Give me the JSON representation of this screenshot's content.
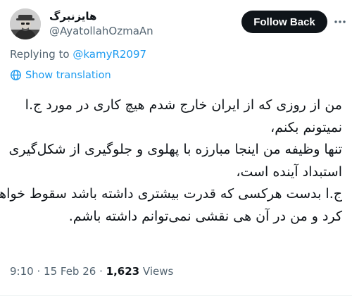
{
  "author": {
    "display_name": "هایزنبرگ",
    "handle": "@AyatollahOzmaAn"
  },
  "follow_button": {
    "label": "Follow Back"
  },
  "more_icon": "more-horizontal-icon",
  "reply_context": {
    "prefix": "Replying to ",
    "mention": "@kamyR2097"
  },
  "translation": {
    "icon": "globe-icon",
    "label": "Show translation"
  },
  "tweet": {
    "lines": [
      "من از روزی که از ایران خارج شدم هیچ کاری در مورد ج.ا",
      "نمیتونم بکنم،",
      "تنها وظیفه من اینجا مبارزه با پهلوی و جلوگیری از شکل‌گیری",
      "استبداد آینده است،",
      "ج.ا بدست هرکسی که قدرت بیشتری داشته باشد سقوط خواهد",
      "کرد و من در آن هی نقشی نمی‌توانم داشته باشم."
    ]
  },
  "meta": {
    "time": "9:10",
    "date": "15 Feb 26",
    "views_count": "1,623",
    "views_label": "Views",
    "separator": "·"
  },
  "colors": {
    "accent": "#1d9bf0",
    "secondary_text": "#536471",
    "primary_text": "#0f1419",
    "button_bg": "#0f1419"
  }
}
